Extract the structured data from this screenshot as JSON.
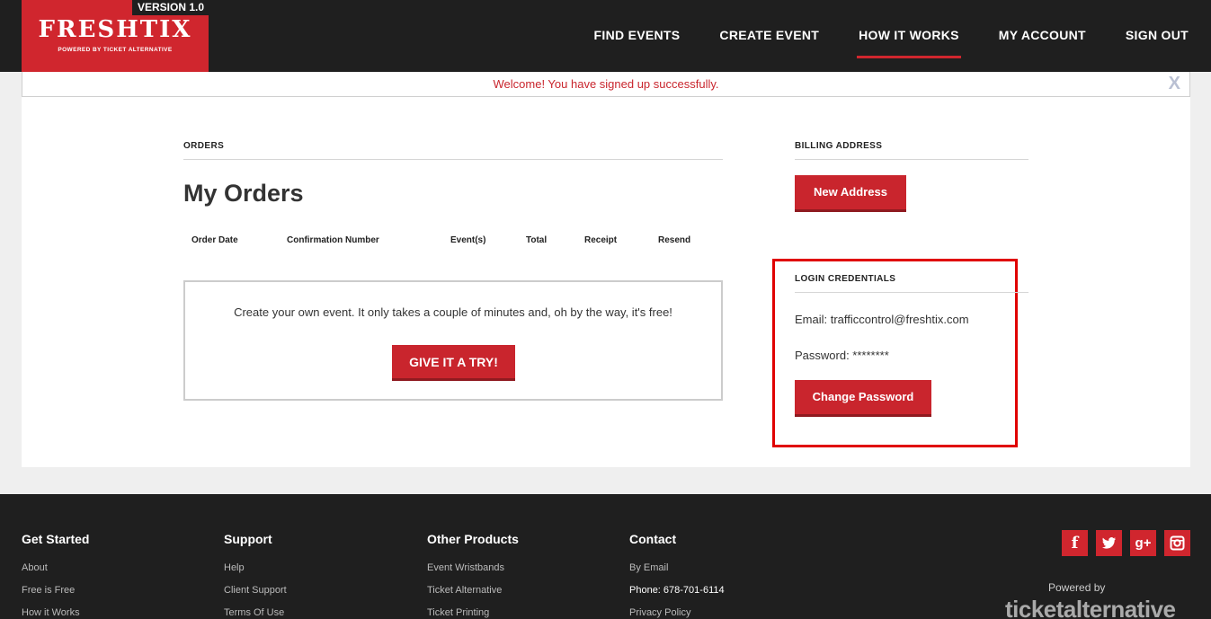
{
  "header": {
    "version": "VERSION 1.0",
    "brand": "FRESHTIX",
    "tagline": "POWERED BY TICKET ALTERNATIVE",
    "nav": [
      "FIND EVENTS",
      "CREATE EVENT",
      "HOW IT WORKS",
      "MY ACCOUNT",
      "SIGN OUT"
    ],
    "active_nav": "HOW IT WORKS"
  },
  "flash": {
    "message": "Welcome! You have signed up successfully.",
    "close": "X"
  },
  "orders": {
    "section_label": "ORDERS",
    "title": "My Orders",
    "columns": [
      "Order Date",
      "Confirmation Number",
      "Event(s)",
      "Total",
      "Receipt",
      "Resend"
    ],
    "promo_text": "Create your own event. It only takes a couple of minutes and, oh by the way, it's free!",
    "promo_button": "GIVE IT A TRY!"
  },
  "billing": {
    "section_label": "BILLING ADDRESS",
    "new_address_button": "New Address"
  },
  "credentials": {
    "section_label": "LOGIN CREDENTIALS",
    "email": "Email: trafficcontrol@freshtix.com",
    "password": "Password: ********",
    "change_password_button": "Change Password"
  },
  "footer": {
    "columns": [
      {
        "heading": "Get Started",
        "links": [
          "About",
          "Free is Free",
          "How it Works"
        ]
      },
      {
        "heading": "Support",
        "links": [
          "Help",
          "Client Support",
          "Terms Of Use"
        ]
      },
      {
        "heading": "Other Products",
        "links": [
          "Event Wristbands",
          "Ticket Alternative",
          "Ticket Printing"
        ]
      },
      {
        "heading": "Contact",
        "links": [
          "By Email",
          "Phone: 678-701-6114",
          "Privacy Policy"
        ]
      }
    ],
    "social": [
      "f",
      "t",
      "g+",
      "ig"
    ],
    "powered_by": "Powered by",
    "partner_logo": "ticketalternative"
  },
  "colors": {
    "brand_red": "#d0262e",
    "dark": "#1f1f1f",
    "highlight": "#e00000"
  }
}
